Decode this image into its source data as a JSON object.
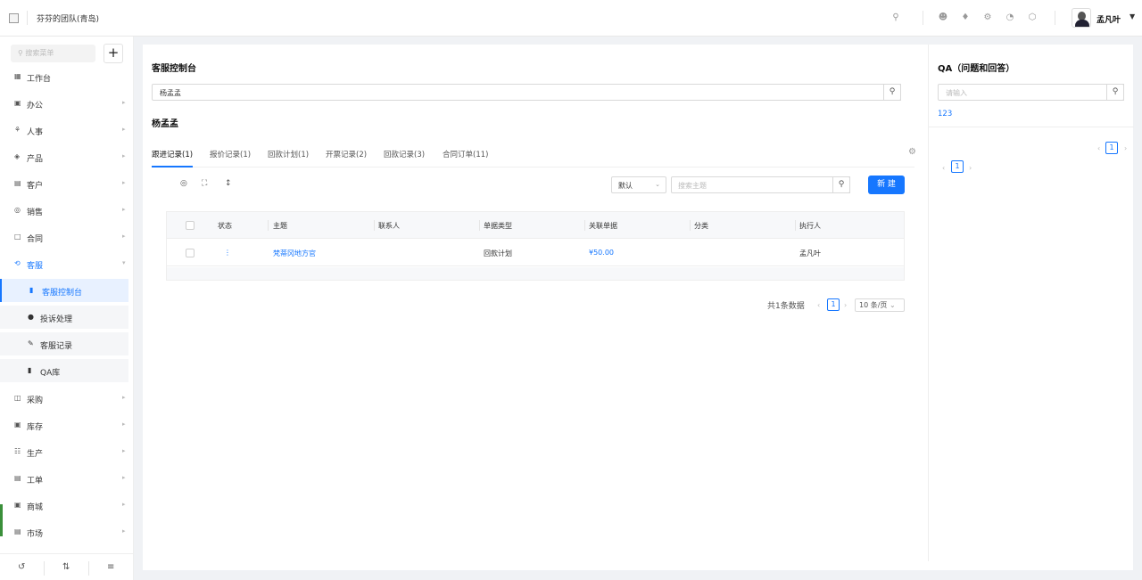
{
  "topbar": {
    "team_name": "芬芬的团队(青岛)",
    "user_name": "孟凡叶",
    "icons": [
      "search-icon",
      "contacts-icon",
      "bell-icon",
      "settings-icon",
      "pie-chart-icon",
      "hexagon-icon"
    ]
  },
  "sidebar": {
    "search_placeholder": "搜索菜单",
    "add_label": "+",
    "items": [
      {
        "label": "工作台",
        "icon": "dashboard-icon"
      },
      {
        "label": "办公",
        "icon": "office-icon"
      },
      {
        "label": "人事",
        "icon": "hr-icon"
      },
      {
        "label": "产品",
        "icon": "product-icon"
      },
      {
        "label": "客户",
        "icon": "customer-icon"
      },
      {
        "label": "销售",
        "icon": "sales-icon"
      },
      {
        "label": "合同",
        "icon": "contract-icon"
      },
      {
        "label": "客服",
        "icon": "service-icon"
      },
      {
        "label": "采购",
        "icon": "purchase-icon"
      },
      {
        "label": "库存",
        "icon": "inventory-icon"
      },
      {
        "label": "生产",
        "icon": "production-icon"
      },
      {
        "label": "工单",
        "icon": "ticket-icon"
      },
      {
        "label": "商城",
        "icon": "mall-icon"
      },
      {
        "label": "市场",
        "icon": "market-icon"
      }
    ],
    "sub_items": [
      {
        "label": "客服控制台",
        "icon": "console-icon"
      },
      {
        "label": "投诉处理",
        "icon": "complaint-icon"
      },
      {
        "label": "客服记录",
        "icon": "record-icon"
      },
      {
        "label": "QA库",
        "icon": "qa-icon"
      }
    ]
  },
  "main": {
    "title": "客服控制台",
    "search_value": "杨孟孟",
    "customer_name": "杨孟孟",
    "tabs": [
      {
        "label": "跟进记录(1)"
      },
      {
        "label": "报价记录(1)"
      },
      {
        "label": "回款计划(1)"
      },
      {
        "label": "开票记录(2)"
      },
      {
        "label": "回款记录(3)"
      },
      {
        "label": "合同订单(11)"
      }
    ],
    "filter_select": "默认",
    "subject_search_placeholder": "搜索主题",
    "new_button": "新 建",
    "table": {
      "headers": [
        "状态",
        "主题",
        "联系人",
        "单据类型",
        "关联单据",
        "分类",
        "执行人"
      ],
      "rows": [
        {
          "status": "⋮",
          "subject": "梵蒂冈地方官",
          "contact": "",
          "doc_type": "回款计划",
          "related": "¥50.00",
          "category": "",
          "executor": "孟凡叶"
        }
      ]
    },
    "pagination": {
      "total_text": "共1条数据",
      "current_page": "1",
      "page_size": "10 条/页"
    }
  },
  "qa_panel": {
    "title": "QA（问题和回答）",
    "search_placeholder": "请输入",
    "items": [
      "123"
    ],
    "page": "1"
  }
}
